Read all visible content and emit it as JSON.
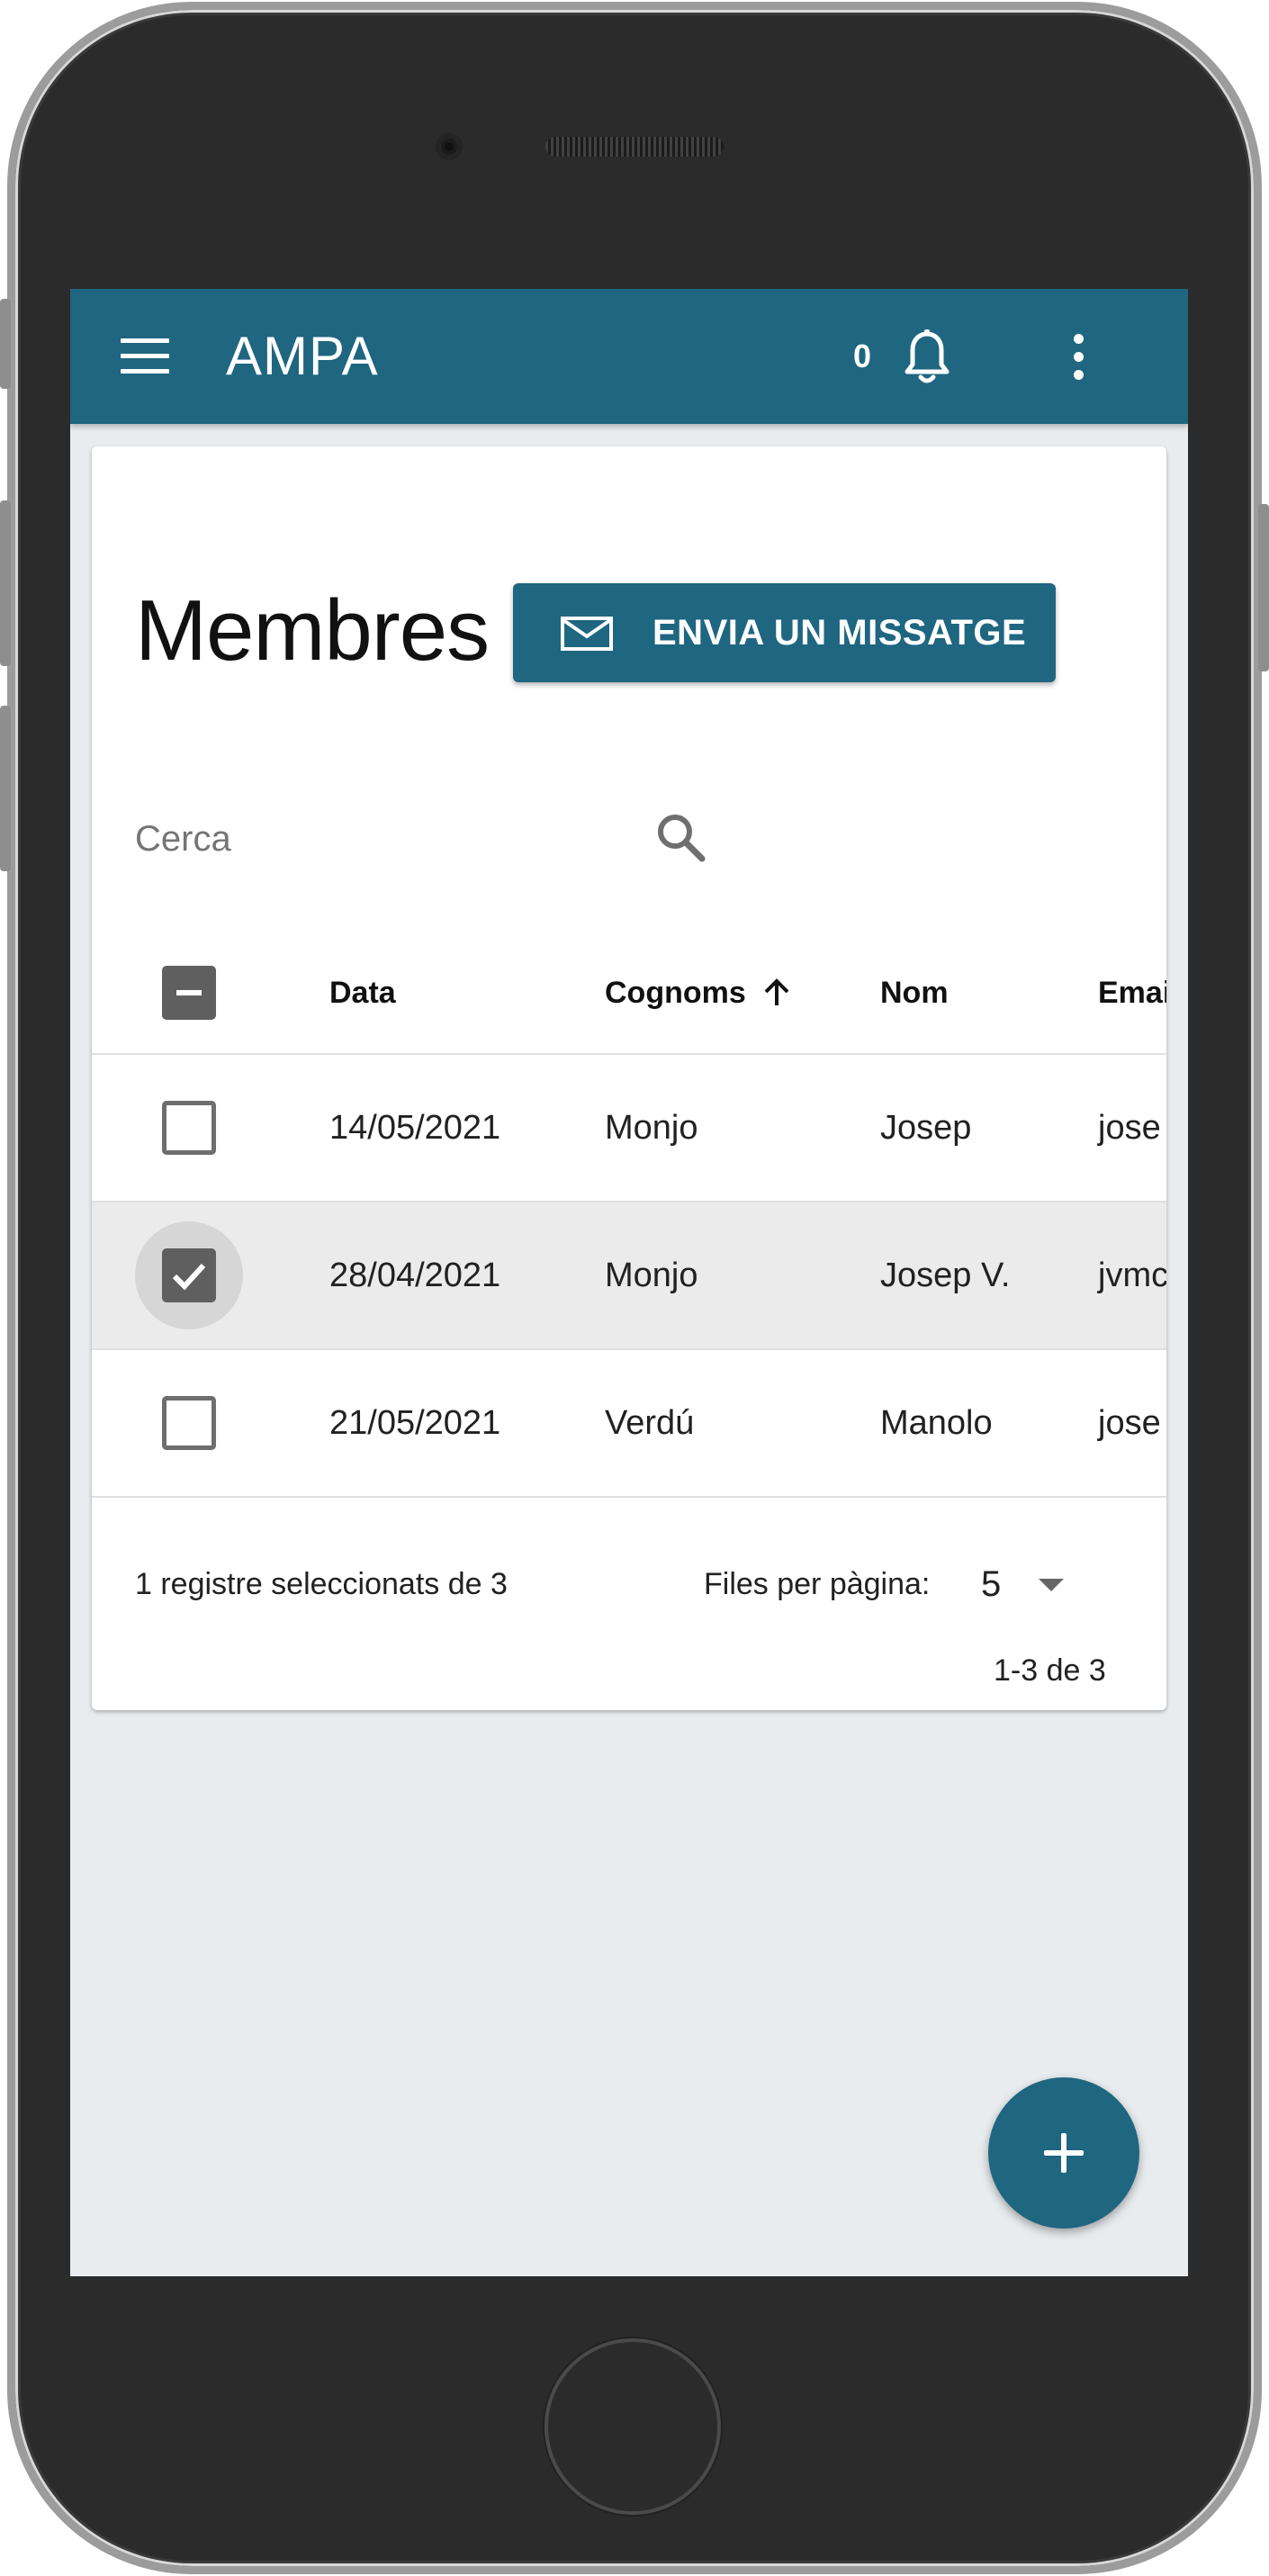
{
  "appbar": {
    "title": "AMPA",
    "notification_count": "0",
    "icons": {
      "menu": "menu-icon",
      "notifications": "bell-icon",
      "more": "more-vert-icon"
    }
  },
  "page": {
    "title": "Membres",
    "send_button_label": "ENVIA UN MISSATGE",
    "send_button_icon": "mail-icon"
  },
  "search": {
    "placeholder": "Cerca",
    "value": ""
  },
  "table": {
    "columns": [
      "Data",
      "Cognoms",
      "Nom",
      "Emai"
    ],
    "sort": {
      "column": "Cognoms",
      "direction": "ascending"
    },
    "header_checkbox": "indeterminate",
    "rows": [
      {
        "selected": false,
        "date": "14/05/2021",
        "surname": "Monjo",
        "name": "Josep",
        "email": "jose"
      },
      {
        "selected": true,
        "date": "28/04/2021",
        "surname": "Monjo",
        "name": "Josep V.",
        "email": "jvmc"
      },
      {
        "selected": false,
        "date": "21/05/2021",
        "surname": "Verdú",
        "name": "Manolo",
        "email": "jose"
      }
    ]
  },
  "footer": {
    "selected_text": "1 registre seleccionats de 3",
    "rows_per_page_label": "Files per pàgina:",
    "rows_per_page_value": "5",
    "range_text": "1-3 de 3"
  },
  "fab": {
    "icon": "plus-icon"
  },
  "colors": {
    "primary": "#1f6680",
    "background": "#e9ecef",
    "selected_row": "#ebebeb"
  }
}
